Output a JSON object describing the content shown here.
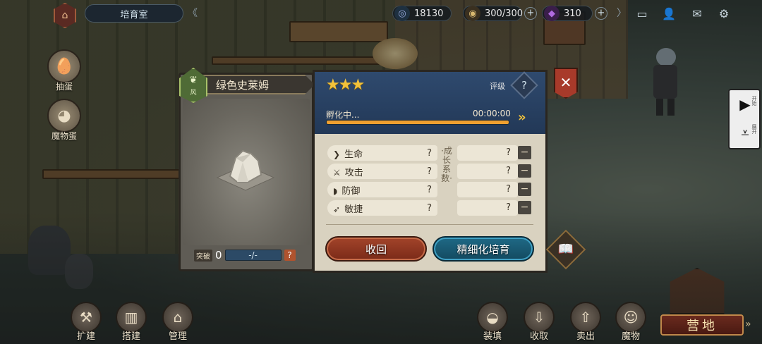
{
  "top_bar": {
    "location_label": "培育室",
    "resources": [
      {
        "icon": "swirl-icon",
        "value": "18130",
        "has_plus": false
      },
      {
        "icon": "coin-stack-icon",
        "value": "300/300",
        "has_plus": true
      },
      {
        "icon": "purple-gem-icon",
        "value": "310",
        "has_plus": true
      }
    ],
    "system_icons": [
      "chat-icon",
      "profile-icon",
      "mail-icon",
      "settings-gear-icon"
    ]
  },
  "side_menu": [
    {
      "label": "抽蛋",
      "icon": "egg-draw-icon"
    },
    {
      "label": "魔物蛋",
      "icon": "monster-egg-icon"
    }
  ],
  "bottom_left": [
    {
      "label": "扩建",
      "icon": "hammer-plus-icon"
    },
    {
      "label": "搭建",
      "icon": "fence-build-icon"
    },
    {
      "label": "管理",
      "icon": "house-gear-icon"
    }
  ],
  "bottom_right": [
    {
      "label": "装填",
      "icon": "nest-icon"
    },
    {
      "label": "收取",
      "icon": "collect-icon"
    },
    {
      "label": "卖出",
      "icon": "sell-icon"
    },
    {
      "label": "魔物",
      "icon": "monster-icon"
    }
  ],
  "camp_button": {
    "label": "营地"
  },
  "egg_panel": {
    "name": "绿色史莱姆",
    "element_tag": "风",
    "break_label": "突破",
    "break_value": "0",
    "break_range": "-/-",
    "break_help": "?"
  },
  "rating": {
    "stars": 3,
    "label": "评级",
    "value": "?"
  },
  "hatch": {
    "label": "孵化中...",
    "time": "00:00:00",
    "progress": 1.0
  },
  "stats": [
    {
      "name": "生命",
      "value": "?",
      "growth": "?",
      "icon": "heart-chevron-icon"
    },
    {
      "name": "攻击",
      "value": "?",
      "growth": "?",
      "icon": "sword-icon"
    },
    {
      "name": "防御",
      "value": "?",
      "growth": "?",
      "icon": "shield-icon"
    },
    {
      "name": "敏捷",
      "value": "?",
      "growth": "?",
      "icon": "wing-icon"
    }
  ],
  "growth_label": "·成长系数·",
  "buttons": {
    "recall": "收回",
    "refine": "精细化培育"
  },
  "close_symbol": "✕",
  "colors": {
    "header_blue": "#2f4a6e",
    "star_gold": "#f3c23a",
    "hatch_bar": "#f0a030",
    "recall_red": "#a3442a",
    "refine_teal": "#1f6a86",
    "close_red": "#a83a2a"
  },
  "controls": {
    "play_label": "开始",
    "down_label": "展开"
  }
}
